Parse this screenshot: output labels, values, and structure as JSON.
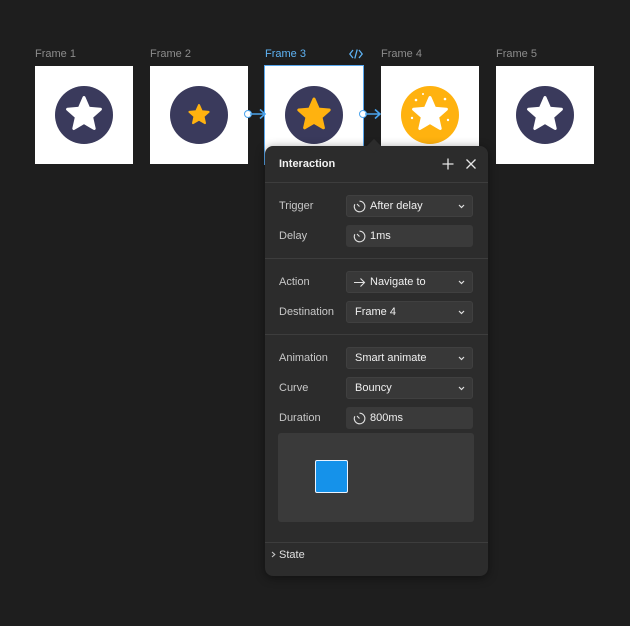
{
  "frames": [
    {
      "label": "Frame 1",
      "state": "default"
    },
    {
      "label": "Frame 2",
      "state": "small-gold"
    },
    {
      "label": "Frame 3",
      "state": "gold"
    },
    {
      "label": "Frame 4",
      "state": "highlight"
    },
    {
      "label": "Frame 5",
      "state": "default"
    }
  ],
  "selected_frame": "Frame 3",
  "panel": {
    "title": "Interaction",
    "add_icon": "plus-icon",
    "close_icon": "close-icon",
    "trigger": {
      "label": "Trigger",
      "value": "After delay",
      "icon": "timer-icon"
    },
    "delay": {
      "label": "Delay",
      "value": "1ms",
      "icon": "timer-icon"
    },
    "action": {
      "label": "Action",
      "value": "Navigate to",
      "icon": "arrow-right-icon"
    },
    "destination": {
      "label": "Destination",
      "value": "Frame 4"
    },
    "animation": {
      "label": "Animation",
      "value": "Smart animate"
    },
    "curve": {
      "label": "Curve",
      "value": "Bouncy"
    },
    "duration": {
      "label": "Duration",
      "value": "800ms",
      "icon": "timer-icon"
    },
    "state": {
      "label": "State"
    }
  },
  "colors": {
    "canvas": "#1e1e1e",
    "panel": "#2c2c2c",
    "accent": "#4aa3ec",
    "star_circle": "#3a3a5c",
    "gold": "#ffb20f",
    "preview_square": "#1592ea"
  }
}
